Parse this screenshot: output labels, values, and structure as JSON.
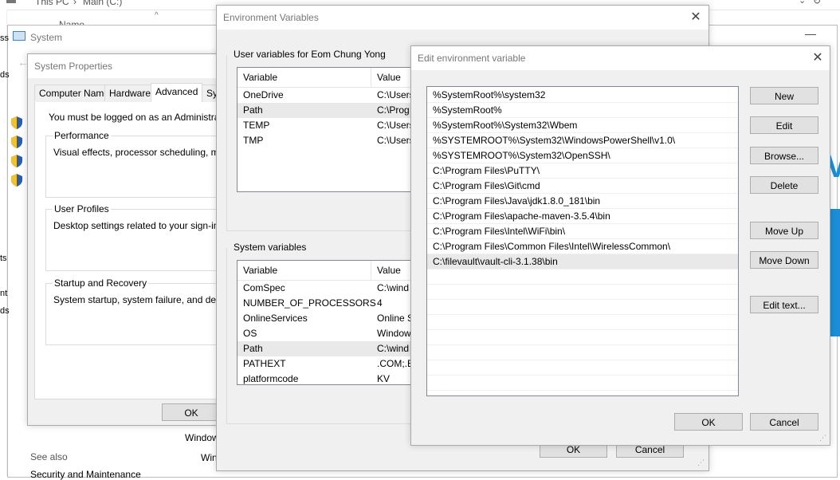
{
  "explorer": {
    "breadcrumb_this_pc": "This PC",
    "breadcrumb_main": "Main (C:)",
    "name_header": "Name"
  },
  "system_window": {
    "title": "System",
    "windows_edition": "Windows",
    "see_also": "See also",
    "security_link": "Security and Maintenance",
    "win_text": "Win"
  },
  "system_properties": {
    "title": "System Properties",
    "tabs": [
      "Computer Name",
      "Hardware",
      "Advanced",
      "Sys"
    ],
    "admin_note": "You must be logged on as an Administrator to",
    "performance": {
      "label": "Performance",
      "desc": "Visual effects, processor scheduling, memor"
    },
    "user_profiles": {
      "label": "User Profiles",
      "desc": "Desktop settings related to your sign-in"
    },
    "startup": {
      "label": "Startup and Recovery",
      "desc": "System startup, system failure, and debuggi"
    },
    "ok": "OK"
  },
  "env_vars": {
    "title": "Environment Variables",
    "user_label": "User variables for Eom Chung Yong",
    "user_headers": {
      "variable": "Variable",
      "value": "Value"
    },
    "user_rows": [
      {
        "variable": "OneDrive",
        "value": "C:\\Users"
      },
      {
        "variable": "Path",
        "value": "C:\\Prog"
      },
      {
        "variable": "TEMP",
        "value": "C:\\Users"
      },
      {
        "variable": "TMP",
        "value": "C:\\Users"
      }
    ],
    "system_label": "System variables",
    "system_headers": {
      "variable": "Variable",
      "value": "Value"
    },
    "system_rows": [
      {
        "variable": "ComSpec",
        "value": "C:\\wind"
      },
      {
        "variable": "NUMBER_OF_PROCESSORS",
        "value": "4"
      },
      {
        "variable": "OnlineServices",
        "value": "Online S"
      },
      {
        "variable": "OS",
        "value": "Window"
      },
      {
        "variable": "Path",
        "value": "C:\\wind"
      },
      {
        "variable": "PATHEXT",
        "value": ".COM;.E"
      },
      {
        "variable": "platformcode",
        "value": "KV"
      }
    ],
    "ok": "OK",
    "cancel": "Cancel"
  },
  "edit_dialog": {
    "title": "Edit environment variable",
    "entries": [
      "%SystemRoot%\\system32",
      "%SystemRoot%",
      "%SystemRoot%\\System32\\Wbem",
      "%SYSTEMROOT%\\System32\\WindowsPowerShell\\v1.0\\",
      "%SYSTEMROOT%\\System32\\OpenSSH\\",
      "C:\\Program Files\\PuTTY\\",
      "C:\\Program Files\\Git\\cmd",
      "C:\\Program Files\\Java\\jdk1.8.0_181\\bin",
      "C:\\Program Files\\apache-maven-3.5.4\\bin",
      "C:\\Program Files\\Intel\\WiFi\\bin\\",
      "C:\\Program Files\\Common Files\\Intel\\WirelessCommon\\",
      "C:\\filevault\\vault-cli-3.1.38\\bin"
    ],
    "selected_index": 11,
    "buttons": {
      "new": "New",
      "edit": "Edit",
      "browse": "Browse...",
      "delete": "Delete",
      "move_up": "Move Up",
      "move_down": "Move Down",
      "edit_text": "Edit text..."
    },
    "ok": "OK",
    "cancel": "Cancel"
  },
  "icons": {
    "close": "close-icon",
    "minimize": "minimize-icon",
    "shield": "uac-shield-icon"
  },
  "colors": {
    "accent": "#0078d7",
    "selection": "#e9e9e9"
  }
}
